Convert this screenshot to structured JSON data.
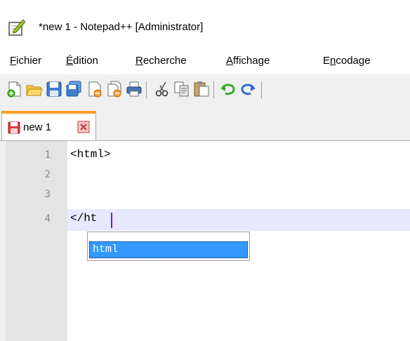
{
  "window": {
    "title": "*new 1 - Notepad++ [Administrator]",
    "icon": "notepadplusplus-icon"
  },
  "menu": [
    {
      "mnemonic": "F",
      "rest": "ichier"
    },
    {
      "mnemonic": "É",
      "rest": "dition"
    },
    {
      "mnemonic": "R",
      "rest": "echerche"
    },
    {
      "mnemonic": "A",
      "rest": "ffichage"
    },
    {
      "pre": "E",
      "mnemonic": "n",
      "rest": "codage"
    }
  ],
  "toolbar": {
    "buttons": [
      "new-file-icon",
      "open-file-icon",
      "save-icon",
      "save-all-icon",
      "close-icon",
      "close-all-icon",
      "print-icon",
      "cut-icon",
      "copy-icon",
      "paste-icon",
      "undo-icon",
      "redo-icon"
    ]
  },
  "tabs": [
    {
      "label": "new 1",
      "modified": true,
      "active": true
    }
  ],
  "editor": {
    "line_numbers": [
      "1",
      "2",
      "3",
      "4"
    ],
    "lines": [
      "<html>",
      "",
      "",
      "</ht"
    ],
    "current_line": 4
  },
  "autocomplete": {
    "items": [
      "html"
    ],
    "selected": "html"
  },
  "colors": {
    "tab_accent": "#fa9d28",
    "current_line": "#e8e8ff",
    "selection": "#3399ff",
    "caret": "#8000ff"
  }
}
